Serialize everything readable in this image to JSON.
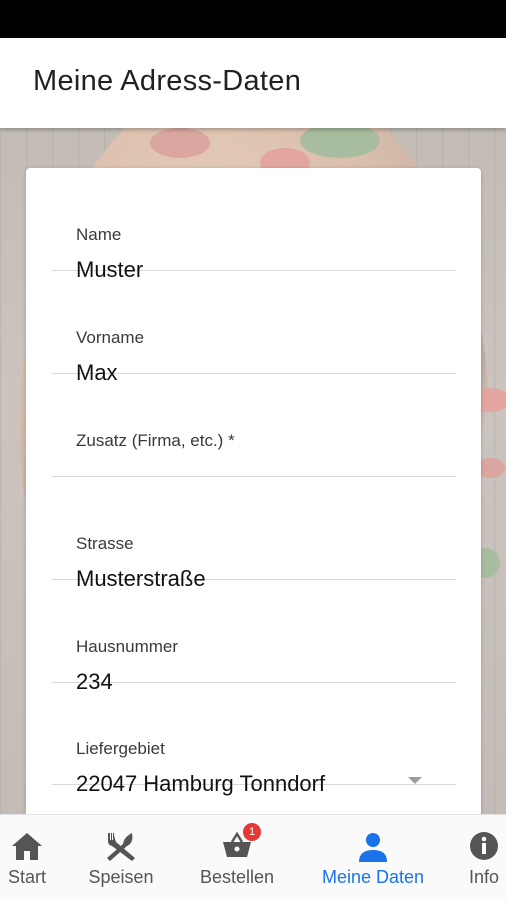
{
  "header": {
    "title": "Meine Adress-Daten"
  },
  "form": {
    "fields": [
      {
        "label": "Name",
        "value": "Muster"
      },
      {
        "label": "Vorname",
        "value": "Max"
      },
      {
        "label": "Zusatz (Firma, etc.) *",
        "value": ""
      },
      {
        "label": "Strasse",
        "value": "Musterstraße"
      },
      {
        "label": "Hausnummer",
        "value": "234"
      },
      {
        "label": "Liefergebiet",
        "value": "22047 Hamburg Tonndorf"
      }
    ]
  },
  "bottom_nav": {
    "items": [
      {
        "label": "Start",
        "icon": "home-icon"
      },
      {
        "label": "Speisen",
        "icon": "cutlery-icon"
      },
      {
        "label": "Bestellen",
        "icon": "basket-icon",
        "badge": "1"
      },
      {
        "label": "Meine Daten",
        "icon": "person-icon",
        "active": true
      },
      {
        "label": "Info",
        "icon": "info-icon"
      }
    ]
  },
  "colors": {
    "active": "#1a73e8",
    "badge": "#e53935"
  }
}
